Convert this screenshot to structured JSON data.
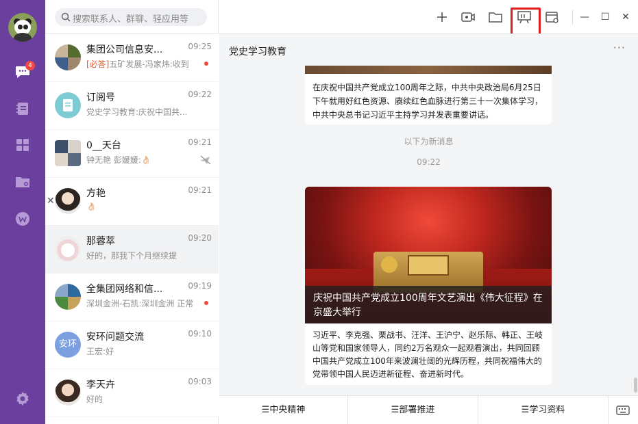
{
  "search": {
    "placeholder": "搜索联系人、群聊、轻应用等"
  },
  "nav": {
    "unread_badge": "4"
  },
  "conversations": [
    {
      "name": "集团公司信息安...",
      "time": "09:25",
      "tag": "[必答]",
      "preview": "五矿发展-冯家炜:收到",
      "unread_dot": true
    },
    {
      "name": "订阅号",
      "time": "09:22",
      "preview": "党史学习教育:庆祝中国共..."
    },
    {
      "name": "0__天台",
      "time": "09:21",
      "preview": "钟无艳 彭媛媛:👌🏻",
      "muted": true
    },
    {
      "name": "方艳",
      "time": "09:21",
      "preview": "👌🏻"
    },
    {
      "name": "那蓉萃",
      "time": "09:20",
      "preview": "好的，那我下个月继续提"
    },
    {
      "name": "全集团网络和信...",
      "time": "09:19",
      "preview": "深圳金洲-石凯:深圳金洲 正常",
      "unread_dot": true
    },
    {
      "name": "安环问题交流",
      "time": "09:10",
      "preview": "王宏:好",
      "avatar_text": "安环"
    },
    {
      "name": "李天卉",
      "time": "09:03",
      "preview": "好的"
    }
  ],
  "chat": {
    "title": "党史学习教育",
    "more": "···",
    "card1_text": "在庆祝中国共产党成立100周年之际，中共中央政治局6月25日下午就用好红色资源、赓续红色血脉进行第三十一次集体学习，中共中央总书记习近平主持学习并发表重要讲话。",
    "new_divider": "以下为新消息",
    "time": "09:22",
    "card2_title": "庆祝中国共产党成立100周年文艺演出《伟大征程》在京盛大举行",
    "card2_text": "习近平、李克强、栗战书、汪洋、王沪宁、赵乐际、韩正、王岐山等党和国家领导人，同约2万名观众一起观看演出，共同回顾中国共产党成立100年来波澜壮阔的光辉历程，共同祝福伟大的党带领中国人民迈进新征程、奋进新时代。"
  },
  "bottom_menu": [
    "☰中央精神",
    "☰部署推进",
    "☰学习资料"
  ],
  "colors": {
    "sidebar": "#6a3f9e",
    "badge": "#f0483e",
    "highlight_box": "#e21c1c"
  }
}
